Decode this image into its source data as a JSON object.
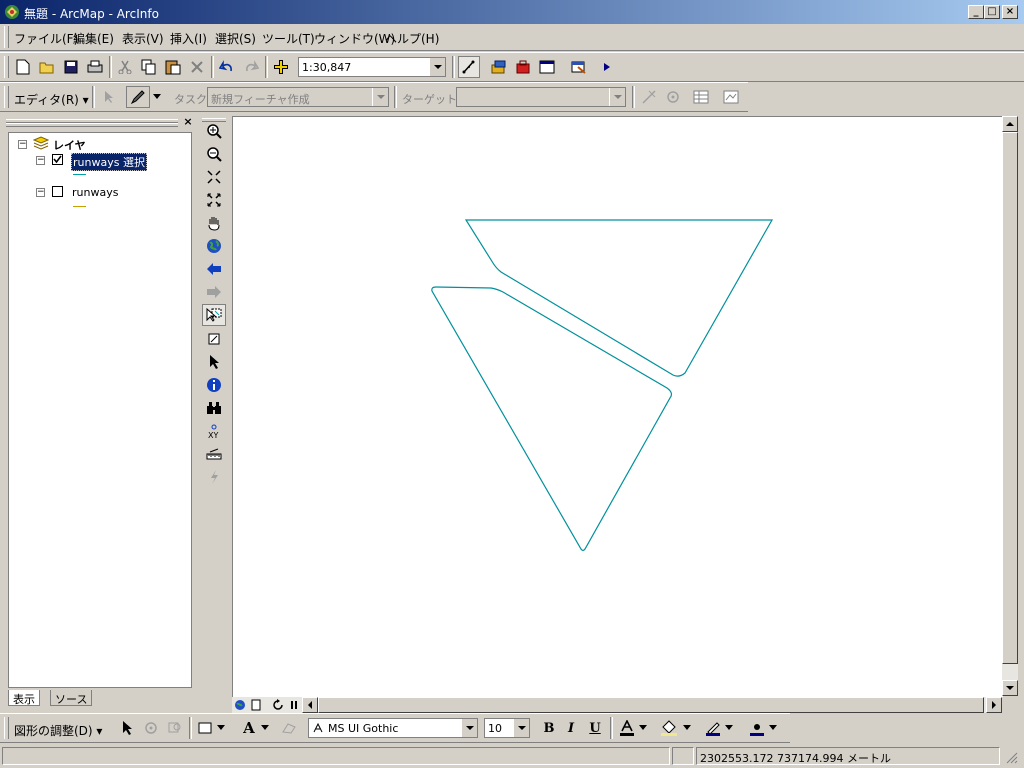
{
  "window": {
    "title": "無題 - ArcMap - ArcInfo",
    "minimize_label": "_",
    "maximize_label": "□",
    "close_label": "×"
  },
  "menu": [
    {
      "label": "ファイル(F)"
    },
    {
      "label": "編集(E)"
    },
    {
      "label": "表示(V)"
    },
    {
      "label": "挿入(I)"
    },
    {
      "label": "選択(S)"
    },
    {
      "label": "ツール(T)"
    },
    {
      "label": "ウィンドウ(W)"
    },
    {
      "label": "ヘルプ(H)"
    }
  ],
  "standard_toolbar": {
    "scale_value": "1:30,847"
  },
  "editor_toolbar": {
    "editor_label": "エディタ(R) ▾",
    "task_label": "タスク:",
    "task_value": "新規フィーチャ作成",
    "target_label": "ターゲット:",
    "target_value": ""
  },
  "toc": {
    "root_label": "レイヤ",
    "layers": [
      {
        "name": "runways 選択",
        "checked": true,
        "selected": true,
        "symbol_color": "#00a0a8"
      },
      {
        "name": "runways",
        "checked": false,
        "selected": false,
        "symbol_color": "#c8a000"
      }
    ],
    "tabs": [
      {
        "label": "表示"
      },
      {
        "label": "ソース"
      }
    ],
    "close_label": "×"
  },
  "draw_toolbar": {
    "drawing_label": "図形の調整(D) ▾",
    "font_value": "MS UI Gothic",
    "font_size_value": "10",
    "bold_label": "B",
    "italic_label": "I",
    "underline_label": "U",
    "text_label": "A"
  },
  "status_bar": {
    "coordinates": "2302553.172  737174.994 メートル"
  },
  "map": {
    "feature_color": "#00909c",
    "background": "#ffffff"
  }
}
